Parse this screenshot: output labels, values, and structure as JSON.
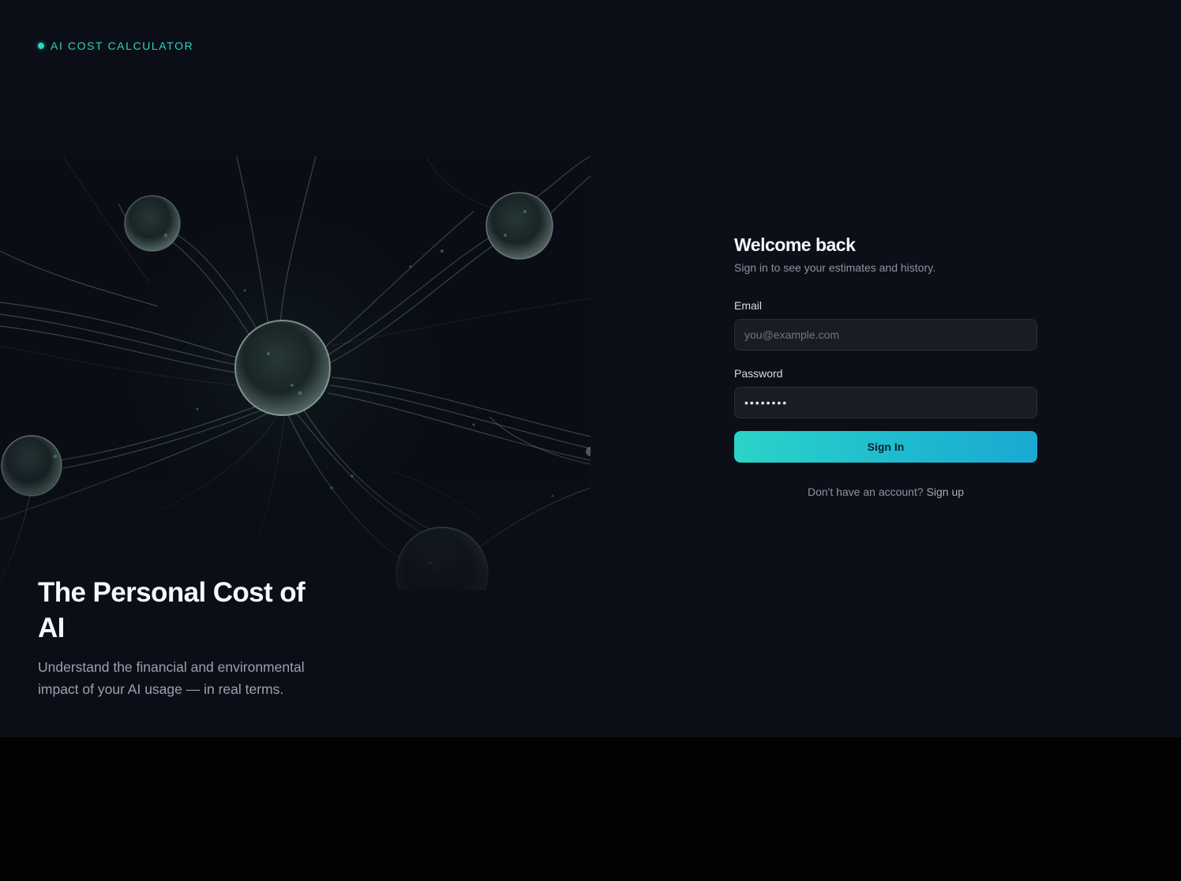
{
  "brand": {
    "name": "AI COST CALCULATOR",
    "accent": "#2dd4bf"
  },
  "hero": {
    "image": "neural-network-illustration",
    "title": "The Personal Cost of AI",
    "subtitle": "Understand the financial and environmental impact of your AI usage — in real terms."
  },
  "login": {
    "title": "Welcome back",
    "subtitle": "Sign in to see your estimates and history.",
    "email_label": "Email",
    "email_placeholder": "you@example.com",
    "email_value": "",
    "password_label": "Password",
    "password_value": "••••••••",
    "submit_label": "Sign In",
    "signup_prompt": "Don't have an account?",
    "signup_link": "Sign up"
  },
  "colors": {
    "button_start": "#2ad4c8",
    "button_end": "#1aa9d2",
    "background": "#0c0f17"
  }
}
